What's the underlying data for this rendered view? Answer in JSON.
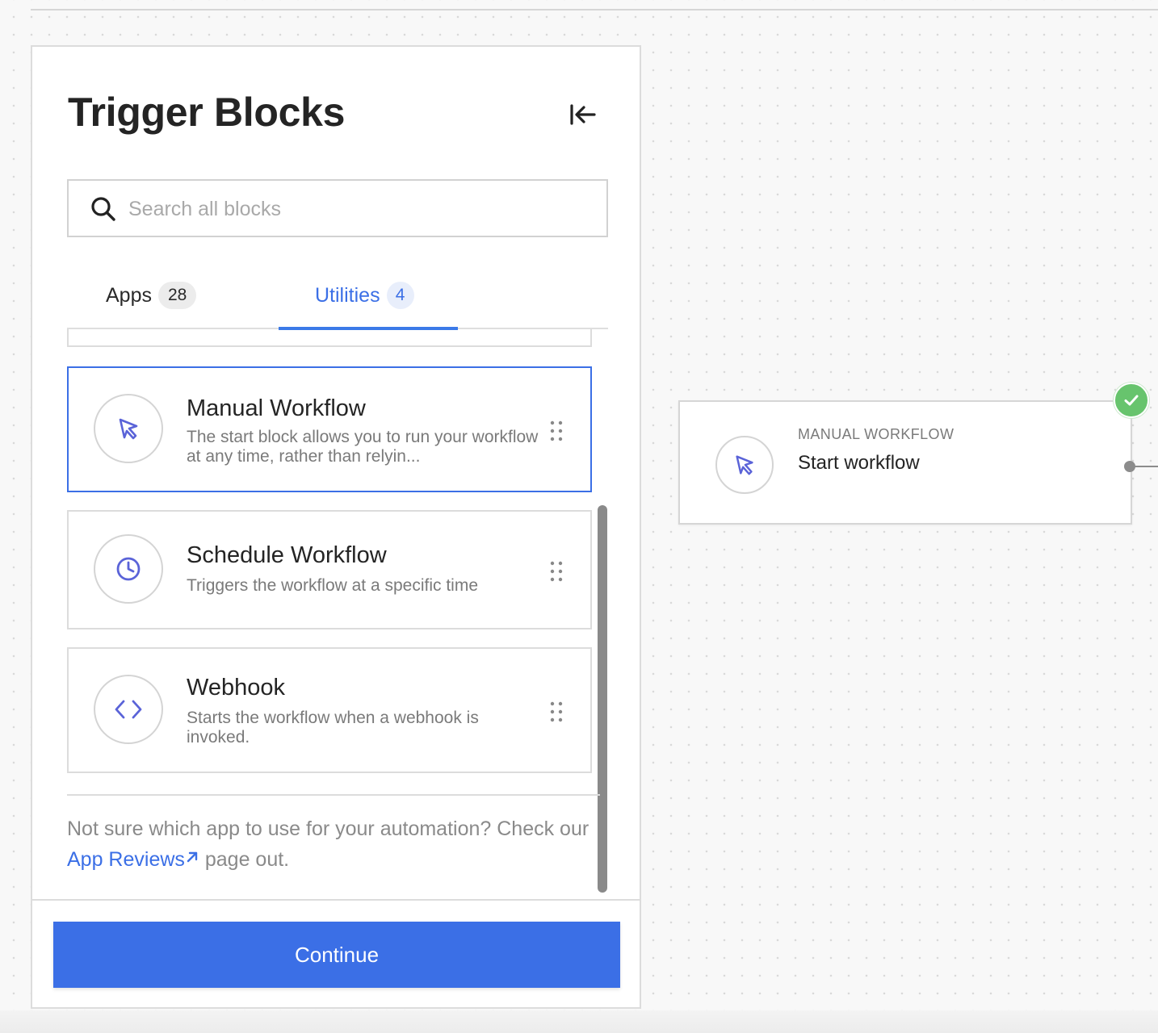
{
  "panel": {
    "title": "Trigger Blocks",
    "collapse_icon": "collapse-left-icon",
    "search": {
      "placeholder": "Search all blocks",
      "value": ""
    },
    "tabs": [
      {
        "label": "Apps",
        "count": "28",
        "active": false
      },
      {
        "label": "Utilities",
        "count": "4",
        "active": true
      }
    ],
    "blocks": [
      {
        "title": "Manual Workflow",
        "description": "The start block allows you to run your workflow at any time, rather than relyin...",
        "icon": "cursor-icon",
        "selected": true
      },
      {
        "title": "Schedule Workflow",
        "description": "Triggers the workflow at a specific time",
        "icon": "clock-icon",
        "selected": false
      },
      {
        "title": "Webhook",
        "description": "Starts the workflow when a webhook is invoked.",
        "icon": "code-icon",
        "selected": false
      }
    ],
    "footer_note": {
      "prefix": "Not sure which app to use for your automation? Check our ",
      "link_text": "App Reviews",
      "suffix": " page out."
    },
    "continue_label": "Continue"
  },
  "node": {
    "type_label": "MANUAL WORKFLOW",
    "title": "Start workflow",
    "icon": "cursor-icon",
    "status_icon": "check-icon"
  },
  "colors": {
    "accent": "#3b6fe6",
    "success": "#67c46d",
    "icon": "#5a63d8"
  }
}
